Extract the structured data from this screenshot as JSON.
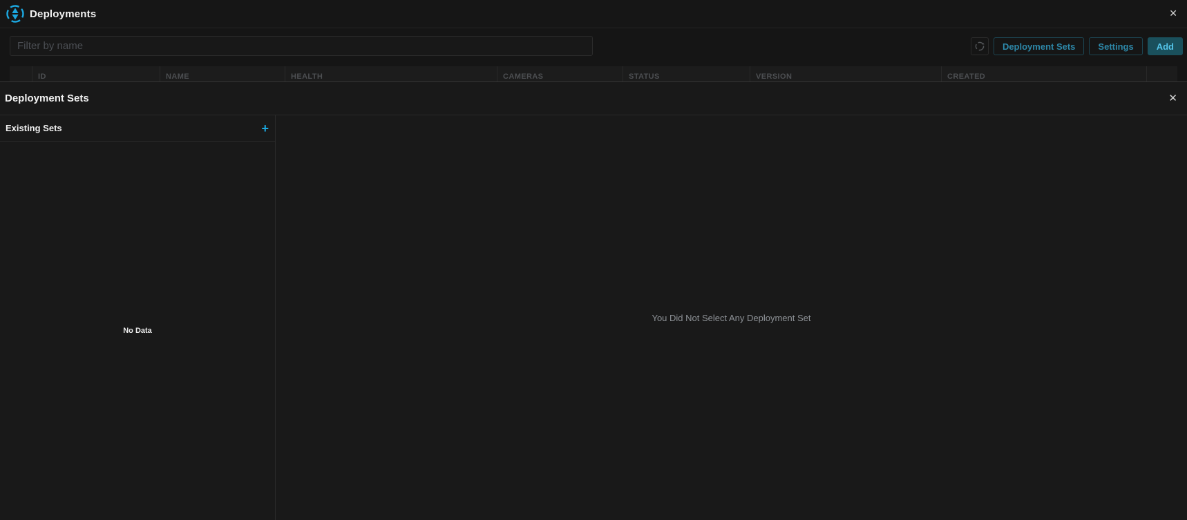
{
  "colors": {
    "accent_cyan": "#1ca8e0",
    "button_text_teal": "#2d87a8",
    "button_border_teal": "#1c4653",
    "add_button_bg": "#1a505c",
    "add_button_text": "#54c5ea",
    "panel_bg": "#191919",
    "muted_text": "#8e9297"
  },
  "icons": {
    "close": "✕",
    "logo": "focus-diamond",
    "refresh": "circular-arrow",
    "add": "+"
  },
  "titlebar": {
    "title": "Deployments"
  },
  "toolbar": {
    "filter_placeholder": "Filter by name",
    "deployment_sets_label": "Deployment Sets",
    "settings_label": "Settings",
    "add_label": "Add"
  },
  "table": {
    "columns": [
      "ID",
      "NAME",
      "HEALTH",
      "CAMERAS",
      "STATUS",
      "VERSION",
      "CREATED"
    ]
  },
  "panel": {
    "title": "Deployment Sets",
    "sidebar": {
      "header": "Existing Sets",
      "add_label": "+",
      "empty_text": "No Data"
    },
    "main": {
      "empty_text": "You Did Not Select Any Deployment Set"
    }
  }
}
